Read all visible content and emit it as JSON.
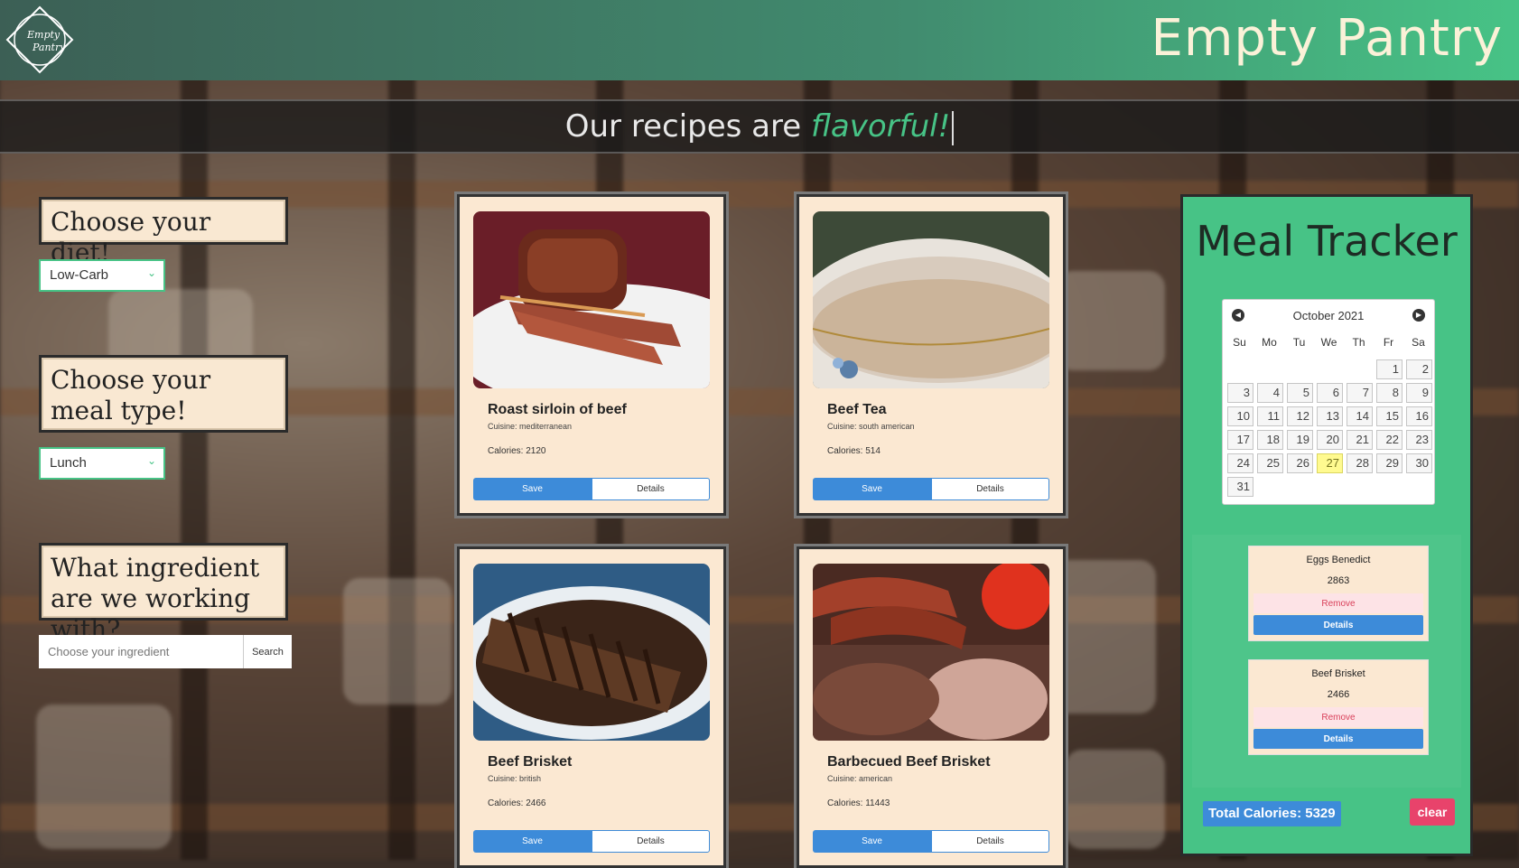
{
  "header": {
    "brand": "Empty Pantry",
    "logo_text_1": "Empty",
    "logo_text_2": "Pantry"
  },
  "banner": {
    "prefix": "Our recipes are ",
    "accent": "flavorful!"
  },
  "filters": {
    "diet_heading": "Choose your diet!",
    "diet_value": "Low-Carb",
    "meal_heading": "Choose your meal type!",
    "meal_value": "Lunch",
    "ingredient_heading": "What ingredient are we working with?",
    "ingredient_placeholder": "Choose your ingredient",
    "search_label": "Search"
  },
  "recipes": [
    {
      "title": "Roast sirloin of beef",
      "cuisine": "Cuisine: mediterranean",
      "calories": "Calories: 2120",
      "save": "Save",
      "details": "Details"
    },
    {
      "title": "Beef Tea",
      "cuisine": "Cuisine: south american",
      "calories": "Calories: 514",
      "save": "Save",
      "details": "Details"
    },
    {
      "title": "Beef Brisket",
      "cuisine": "Cuisine: british",
      "calories": "Calories: 2466",
      "save": "Save",
      "details": "Details"
    },
    {
      "title": "Barbecued Beef Brisket",
      "cuisine": "Cuisine: american",
      "calories": "Calories: 11443",
      "save": "Save",
      "details": "Details"
    }
  ],
  "tracker": {
    "title": "Meal Tracker",
    "calendar": {
      "month_label": "October 2021",
      "weekdays": [
        "Su",
        "Mo",
        "Tu",
        "We",
        "Th",
        "Fr",
        "Sa"
      ],
      "days": [
        "1",
        "2",
        "3",
        "4",
        "5",
        "6",
        "7",
        "8",
        "9",
        "10",
        "11",
        "12",
        "13",
        "14",
        "15",
        "16",
        "17",
        "18",
        "19",
        "20",
        "21",
        "22",
        "23",
        "24",
        "25",
        "26",
        "27",
        "28",
        "29",
        "30",
        "31"
      ],
      "today": "27"
    },
    "meals": [
      {
        "name": "Eggs Benedict",
        "calories": "2863",
        "remove": "Remove",
        "details": "Details"
      },
      {
        "name": "Beef Brisket",
        "calories": "2466",
        "remove": "Remove",
        "details": "Details"
      }
    ],
    "total_label": "Total Calories: 5329",
    "clear_label": "clear"
  },
  "colors": {
    "accent_green": "#47c386",
    "button_blue": "#3d8bd9",
    "card_bg": "#fbe8d2",
    "clear_red": "#e8436b"
  }
}
